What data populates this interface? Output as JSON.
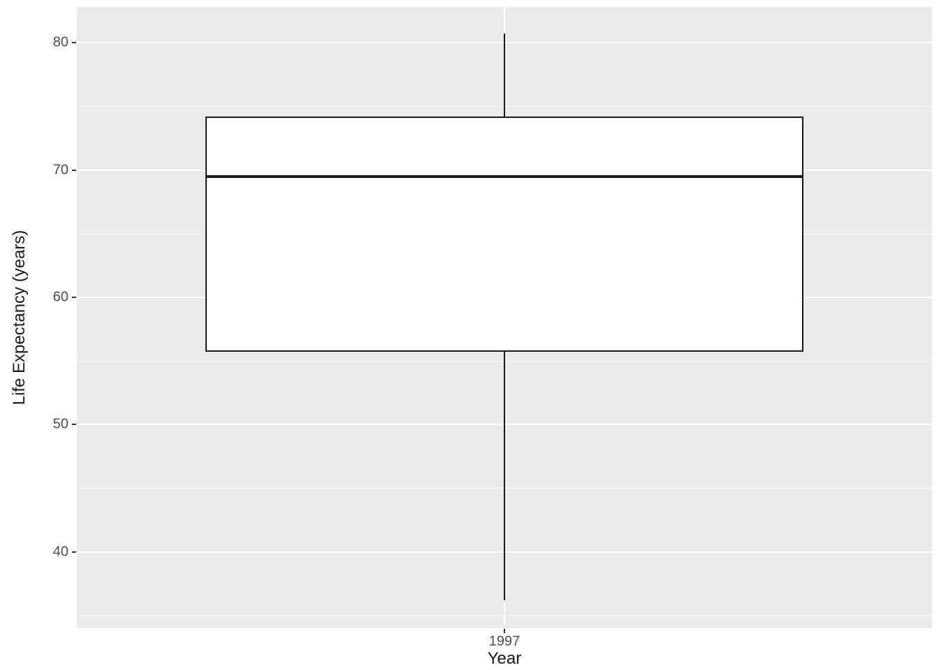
{
  "chart_data": {
    "type": "boxplot",
    "xlabel": "Year",
    "ylabel": "Life Expectancy (years)",
    "categories": [
      "1997"
    ],
    "series": [
      {
        "name": "1997",
        "whisker_low": 36.2,
        "q1": 55.7,
        "median": 69.5,
        "q3": 74.2,
        "whisker_high": 80.7
      }
    ],
    "y_ticks": [
      40,
      50,
      60,
      70,
      80
    ],
    "ylim_visual": [
      34.0,
      82.8
    ],
    "grid_major": true,
    "grid_minor": true,
    "title": "",
    "subtitle": ""
  }
}
